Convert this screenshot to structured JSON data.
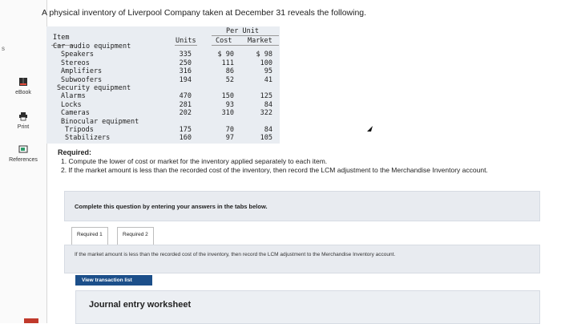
{
  "intro": "A physical inventory of Liverpool Company taken at December 31 reveals the following.",
  "sidebar": {
    "edge_text": "s",
    "items": [
      {
        "label": "eBook",
        "icon": "book-icon"
      },
      {
        "label": "Print",
        "icon": "printer-icon"
      },
      {
        "label": "References",
        "icon": "references-icon"
      }
    ]
  },
  "table": {
    "headers": {
      "item": "Item",
      "units": "Units",
      "per_unit": "Per Unit",
      "cost": "Cost",
      "market": "Market"
    },
    "rows": [
      {
        "label": "Car audio equipment",
        "indent": 0,
        "units": "",
        "cost": "",
        "market": ""
      },
      {
        "label": "Speakers",
        "indent": 1,
        "units": "335",
        "cost": "$ 90",
        "market": "$ 98"
      },
      {
        "label": "Stereos",
        "indent": 1,
        "units": "250",
        "cost": "111",
        "market": "100"
      },
      {
        "label": "Amplifiers",
        "indent": 1,
        "units": "316",
        "cost": "86",
        "market": "95"
      },
      {
        "label": "Subwoofers",
        "indent": 1,
        "units": "194",
        "cost": "52",
        "market": "41"
      },
      {
        "label": "Security equipment",
        "indent": 0.5,
        "units": "",
        "cost": "",
        "market": ""
      },
      {
        "label": "Alarms",
        "indent": 1,
        "units": "470",
        "cost": "150",
        "market": "125"
      },
      {
        "label": "Locks",
        "indent": 1,
        "units": "281",
        "cost": "93",
        "market": "84"
      },
      {
        "label": "Cameras",
        "indent": 1,
        "units": "202",
        "cost": "310",
        "market": "322"
      },
      {
        "label": "Binocular equipment",
        "indent": 1,
        "units": "",
        "cost": "",
        "market": ""
      },
      {
        "label": "Tripods",
        "indent": 1.5,
        "units": "175",
        "cost": "70",
        "market": "84"
      },
      {
        "label": "Stabilizers",
        "indent": 1.5,
        "units": "160",
        "cost": "97",
        "market": "105"
      }
    ]
  },
  "required": {
    "title": "Required:",
    "items": [
      "1. Compute the lower of cost or market for the inventory applied separately to each item.",
      "2. If the market amount is less than the recorded cost of the inventory, then record the LCM adjustment to the Merchandise Inventory account."
    ]
  },
  "complete_text": "Complete this question by entering your answers in the tabs below.",
  "tabs": [
    {
      "label": "Required 1"
    },
    {
      "label": "Required 2"
    }
  ],
  "panel_text": "If the market amount is less than the recorded cost of the inventory, then record the LCM adjustment to the Merchandise Inventory account.",
  "view_transaction_label": "View transaction list",
  "journal_title": "Journal entry worksheet",
  "colors": {
    "accent": "#1c4f8a",
    "panel": "#e8ebf0",
    "table_bg": "#e9edf2",
    "brand_red": "#c0392b"
  }
}
